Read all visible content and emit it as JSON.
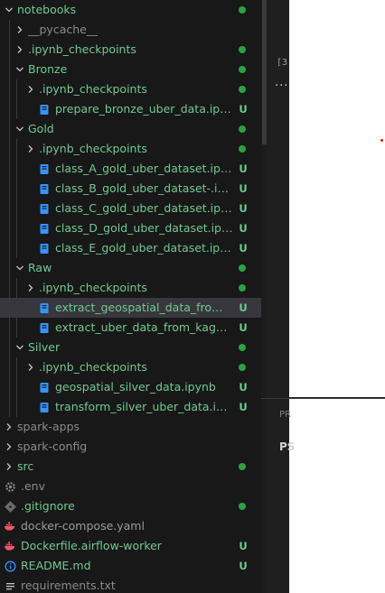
{
  "explorer": {
    "rows": [
      {
        "type": "folder",
        "open": true,
        "label": "notebooks",
        "color": "#73c991",
        "dot": "#2ea043"
      },
      {
        "type": "folder",
        "open": false,
        "label": "__pycache__",
        "color": "#8b8b8b"
      },
      {
        "type": "folder",
        "open": false,
        "label": ".ipynb_checkpoints",
        "color": "#73c991",
        "dot": "#2ea043"
      },
      {
        "type": "folder",
        "open": true,
        "label": "Bronze",
        "color": "#73c991",
        "dot": "#2ea043"
      },
      {
        "type": "folder",
        "open": false,
        "label": ".ipynb_checkpoints",
        "color": "#73c991",
        "dot": "#2ea043"
      },
      {
        "type": "notebook",
        "label": "prepare_bronze_uber_data.ipynb",
        "color": "#73c991",
        "badge": "U"
      },
      {
        "type": "folder",
        "open": true,
        "label": "Gold",
        "color": "#73c991",
        "dot": "#2ea043"
      },
      {
        "type": "folder",
        "open": false,
        "label": ".ipynb_checkpoints",
        "color": "#73c991",
        "dot": "#2ea043"
      },
      {
        "type": "notebook",
        "label": "class_A_gold_uber_dataset.ipynb",
        "color": "#73c991",
        "badge": "U"
      },
      {
        "type": "notebook",
        "label": "class_B_gold_uber_dataset-.ipynb",
        "color": "#73c991",
        "badge": "U"
      },
      {
        "type": "notebook",
        "label": "class_C_gold_uber_dataset.ipynb",
        "color": "#73c991",
        "badge": "U"
      },
      {
        "type": "notebook",
        "label": "class_D_gold_uber_dataset.ipynb",
        "color": "#73c991",
        "badge": "U"
      },
      {
        "type": "notebook",
        "label": "class_E_gold_uber_dataset.ipynb",
        "color": "#73c991",
        "badge": "U"
      },
      {
        "type": "folder",
        "open": true,
        "label": "Raw",
        "color": "#73c991",
        "dot": "#2ea043"
      },
      {
        "type": "folder",
        "open": false,
        "label": ".ipynb_checkpoints",
        "color": "#73c991",
        "dot": "#2ea043"
      },
      {
        "type": "notebook",
        "label": "extract_geospatial_data_from_census...",
        "color": "#73c991",
        "badge": "U",
        "selected": true
      },
      {
        "type": "notebook",
        "label": "extract_uber_data_from_kaggle.ipynb",
        "color": "#73c991",
        "badge": "U"
      },
      {
        "type": "folder",
        "open": true,
        "label": "Silver",
        "color": "#73c991",
        "dot": "#2ea043"
      },
      {
        "type": "folder",
        "open": false,
        "label": ".ipynb_checkpoints",
        "color": "#73c991",
        "dot": "#2ea043"
      },
      {
        "type": "notebook",
        "label": "geospatial_silver_data.ipynb",
        "color": "#73c991",
        "badge": "U"
      },
      {
        "type": "notebook",
        "label": "transform_silver_uber_data.ipynb",
        "color": "#73c991",
        "badge": "U"
      },
      {
        "type": "folder",
        "open": false,
        "label": "spark-apps",
        "color": "#8b8b8b"
      },
      {
        "type": "folder",
        "open": false,
        "label": "spark-config",
        "color": "#8b8b8b"
      },
      {
        "type": "folder",
        "open": false,
        "label": "src",
        "color": "#73c991",
        "dot": "#2ea043"
      },
      {
        "type": "gear",
        "label": ".env",
        "color": "#8b8b8b"
      },
      {
        "type": "git",
        "label": ".gitignore",
        "color": "#73c991",
        "dot": "#2ea043"
      },
      {
        "type": "docker",
        "label": "docker-compose.yaml",
        "color": "#9b9b9b"
      },
      {
        "type": "docker",
        "label": "Dockerfile.airflow-worker",
        "color": "#73c991",
        "badge": "U"
      },
      {
        "type": "info",
        "label": "README.md",
        "color": "#73c991",
        "badge": "U"
      },
      {
        "type": "lines",
        "label": "requirements.txt",
        "color": "#8b8b8b"
      }
    ]
  },
  "editor": {
    "cell_number": "[3",
    "more_glyph": "···",
    "panel_tab": "PR",
    "panel_text": "PS"
  },
  "colors": {
    "untracked": "#73c991",
    "ignored": "#8b8b8b",
    "dot": "#2ea043",
    "notebook_icon": "#3794ff",
    "docker_icon": "#f05568",
    "selection": "#37373d"
  }
}
